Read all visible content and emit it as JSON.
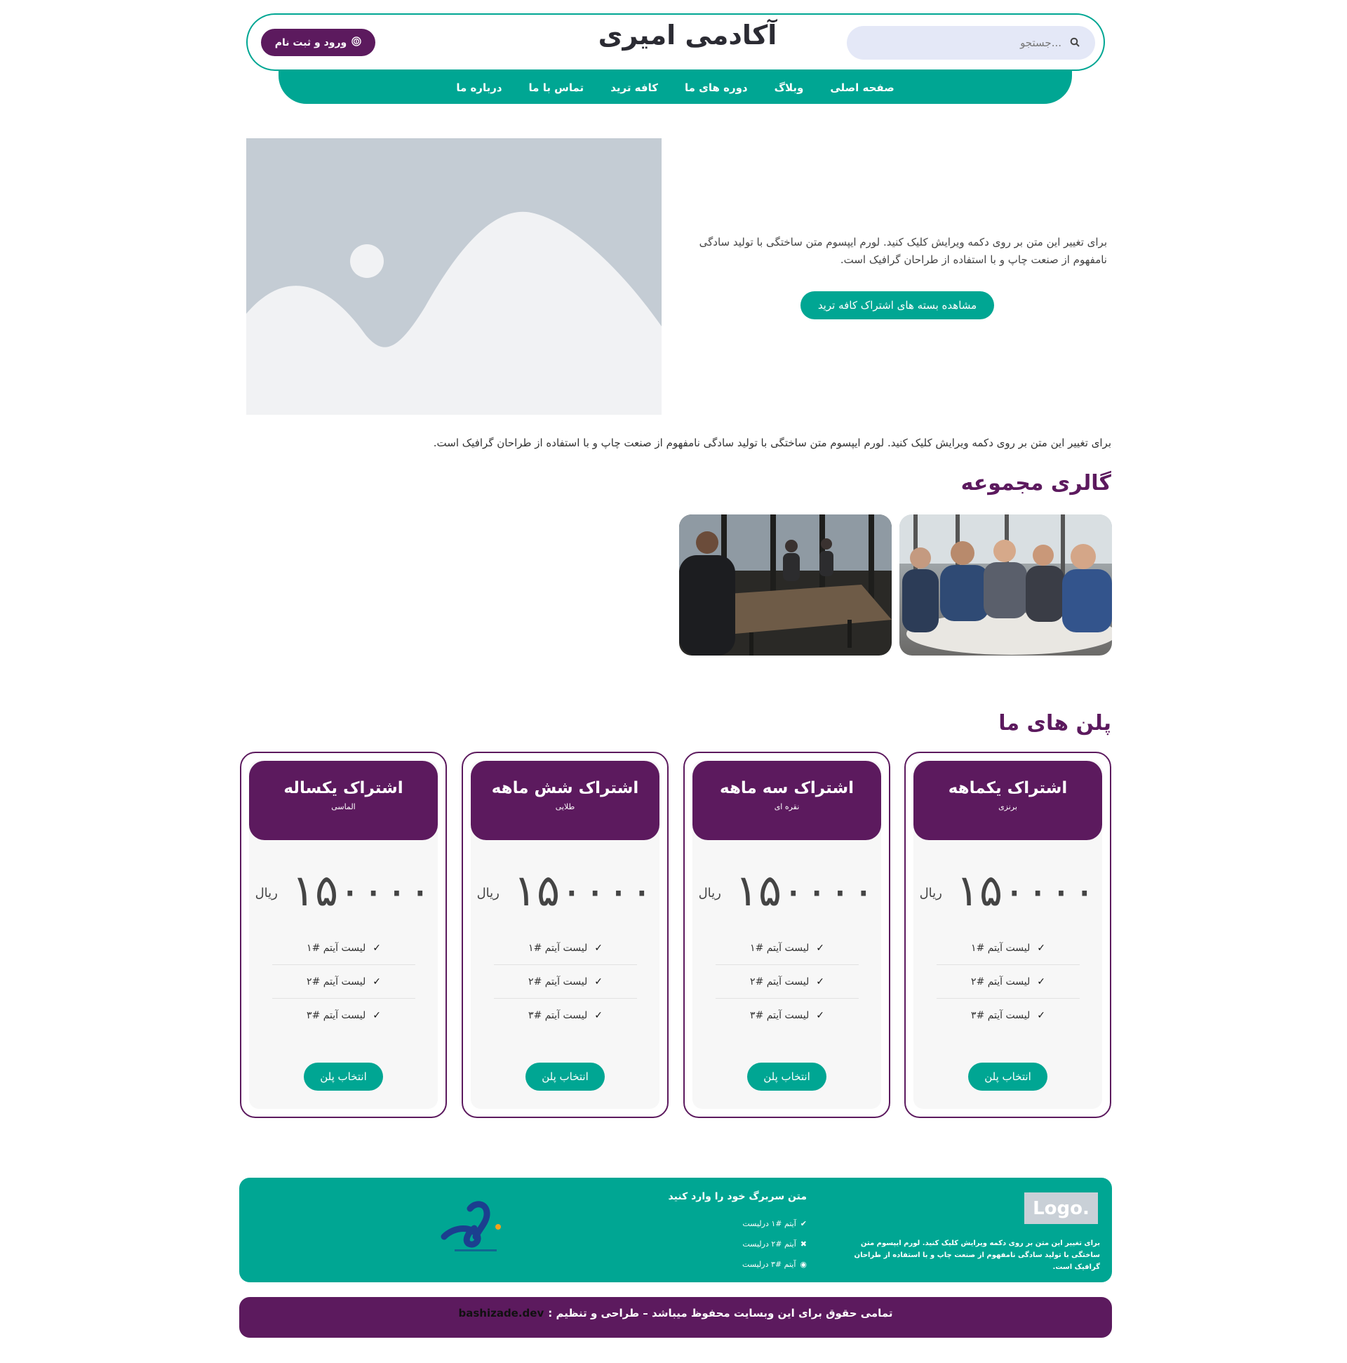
{
  "header": {
    "title": "آکادمی امیری",
    "search_placeholder": "جستجو...",
    "login_label": "ورود و ثبت نام",
    "nav": [
      "صفحه اصلی",
      "وبلاگ",
      "دوره های ما",
      "کافه ترید",
      "تماس با ما",
      "درباره ما"
    ]
  },
  "hero": {
    "text": "برای تغییر این متن بر روی دکمه ویرایش کلیک کنید. لورم ایپسوم متن ساختگی با تولید سادگی نامفهوم از صنعت چاپ و با استفاده از طراحان گرافیک است.",
    "button": "مشاهده بسته های اشتراک کافه ترید"
  },
  "intro_text": "برای تغییر این متن بر روی دکمه ویرایش کلیک کنید. لورم ایپسوم متن ساختگی با تولید سادگی نامفهوم از صنعت چاپ و با استفاده از طراحان گرافیک است.",
  "gallery": {
    "title": "گالری مجموعه"
  },
  "plans": {
    "title": "پلن های ما",
    "items": [
      {
        "name": "اشتراک یکماهه",
        "tier": "برنزی",
        "price": "۱۵۰۰۰۰",
        "currency": "ریال",
        "features": [
          "لیست آیتم #۱",
          "لیست آیتم #۲",
          "لیست آیتم #۳"
        ],
        "button": "انتخاب پلن"
      },
      {
        "name": "اشتراک سه ماهه",
        "tier": "نقره ای",
        "price": "۱۵۰۰۰۰",
        "currency": "ریال",
        "features": [
          "لیست آیتم #۱",
          "لیست آیتم #۲",
          "لیست آیتم #۳"
        ],
        "button": "انتخاب پلن"
      },
      {
        "name": "اشتراک شش ماهه",
        "tier": "طلایی",
        "price": "۱۵۰۰۰۰",
        "currency": "ریال",
        "features": [
          "لیست آیتم #۱",
          "لیست آیتم #۲",
          "لیست آیتم #۳"
        ],
        "button": "انتخاب پلن"
      },
      {
        "name": "اشتراک یکساله",
        "tier": "الماسی",
        "price": "۱۵۰۰۰۰",
        "currency": "ریال",
        "features": [
          "لیست آیتم #۱",
          "لیست آیتم #۲",
          "لیست آیتم #۳"
        ],
        "button": "انتخاب پلن"
      }
    ]
  },
  "footer": {
    "logo": "Logo.",
    "text": "برای تغییر این متن بر روی دکمه ویرایش کلیک کنید. لورم ایپسوم متن ساختگی با تولید سادگی نامفهوم از صنعت چاپ و با استفاده از طراحان گرافیک است.",
    "heading": "متن سربرگ خود را وارد کنید",
    "list": [
      {
        "icon": "check-icon",
        "label": "آیتم #۱ درلیست"
      },
      {
        "icon": "close-icon",
        "label": "آیتم #۲ درلیست"
      },
      {
        "icon": "circle-dot-icon",
        "label": "آیتم #۳ درلیست"
      }
    ]
  },
  "copyright": {
    "text": "تمامی حقوق برای این وبسایت محفوظ میباشد – طراحی و تنظیم :",
    "dev": "bashizade.dev"
  },
  "colors": {
    "primary": "#00a693",
    "secondary": "#5c1a5e"
  }
}
